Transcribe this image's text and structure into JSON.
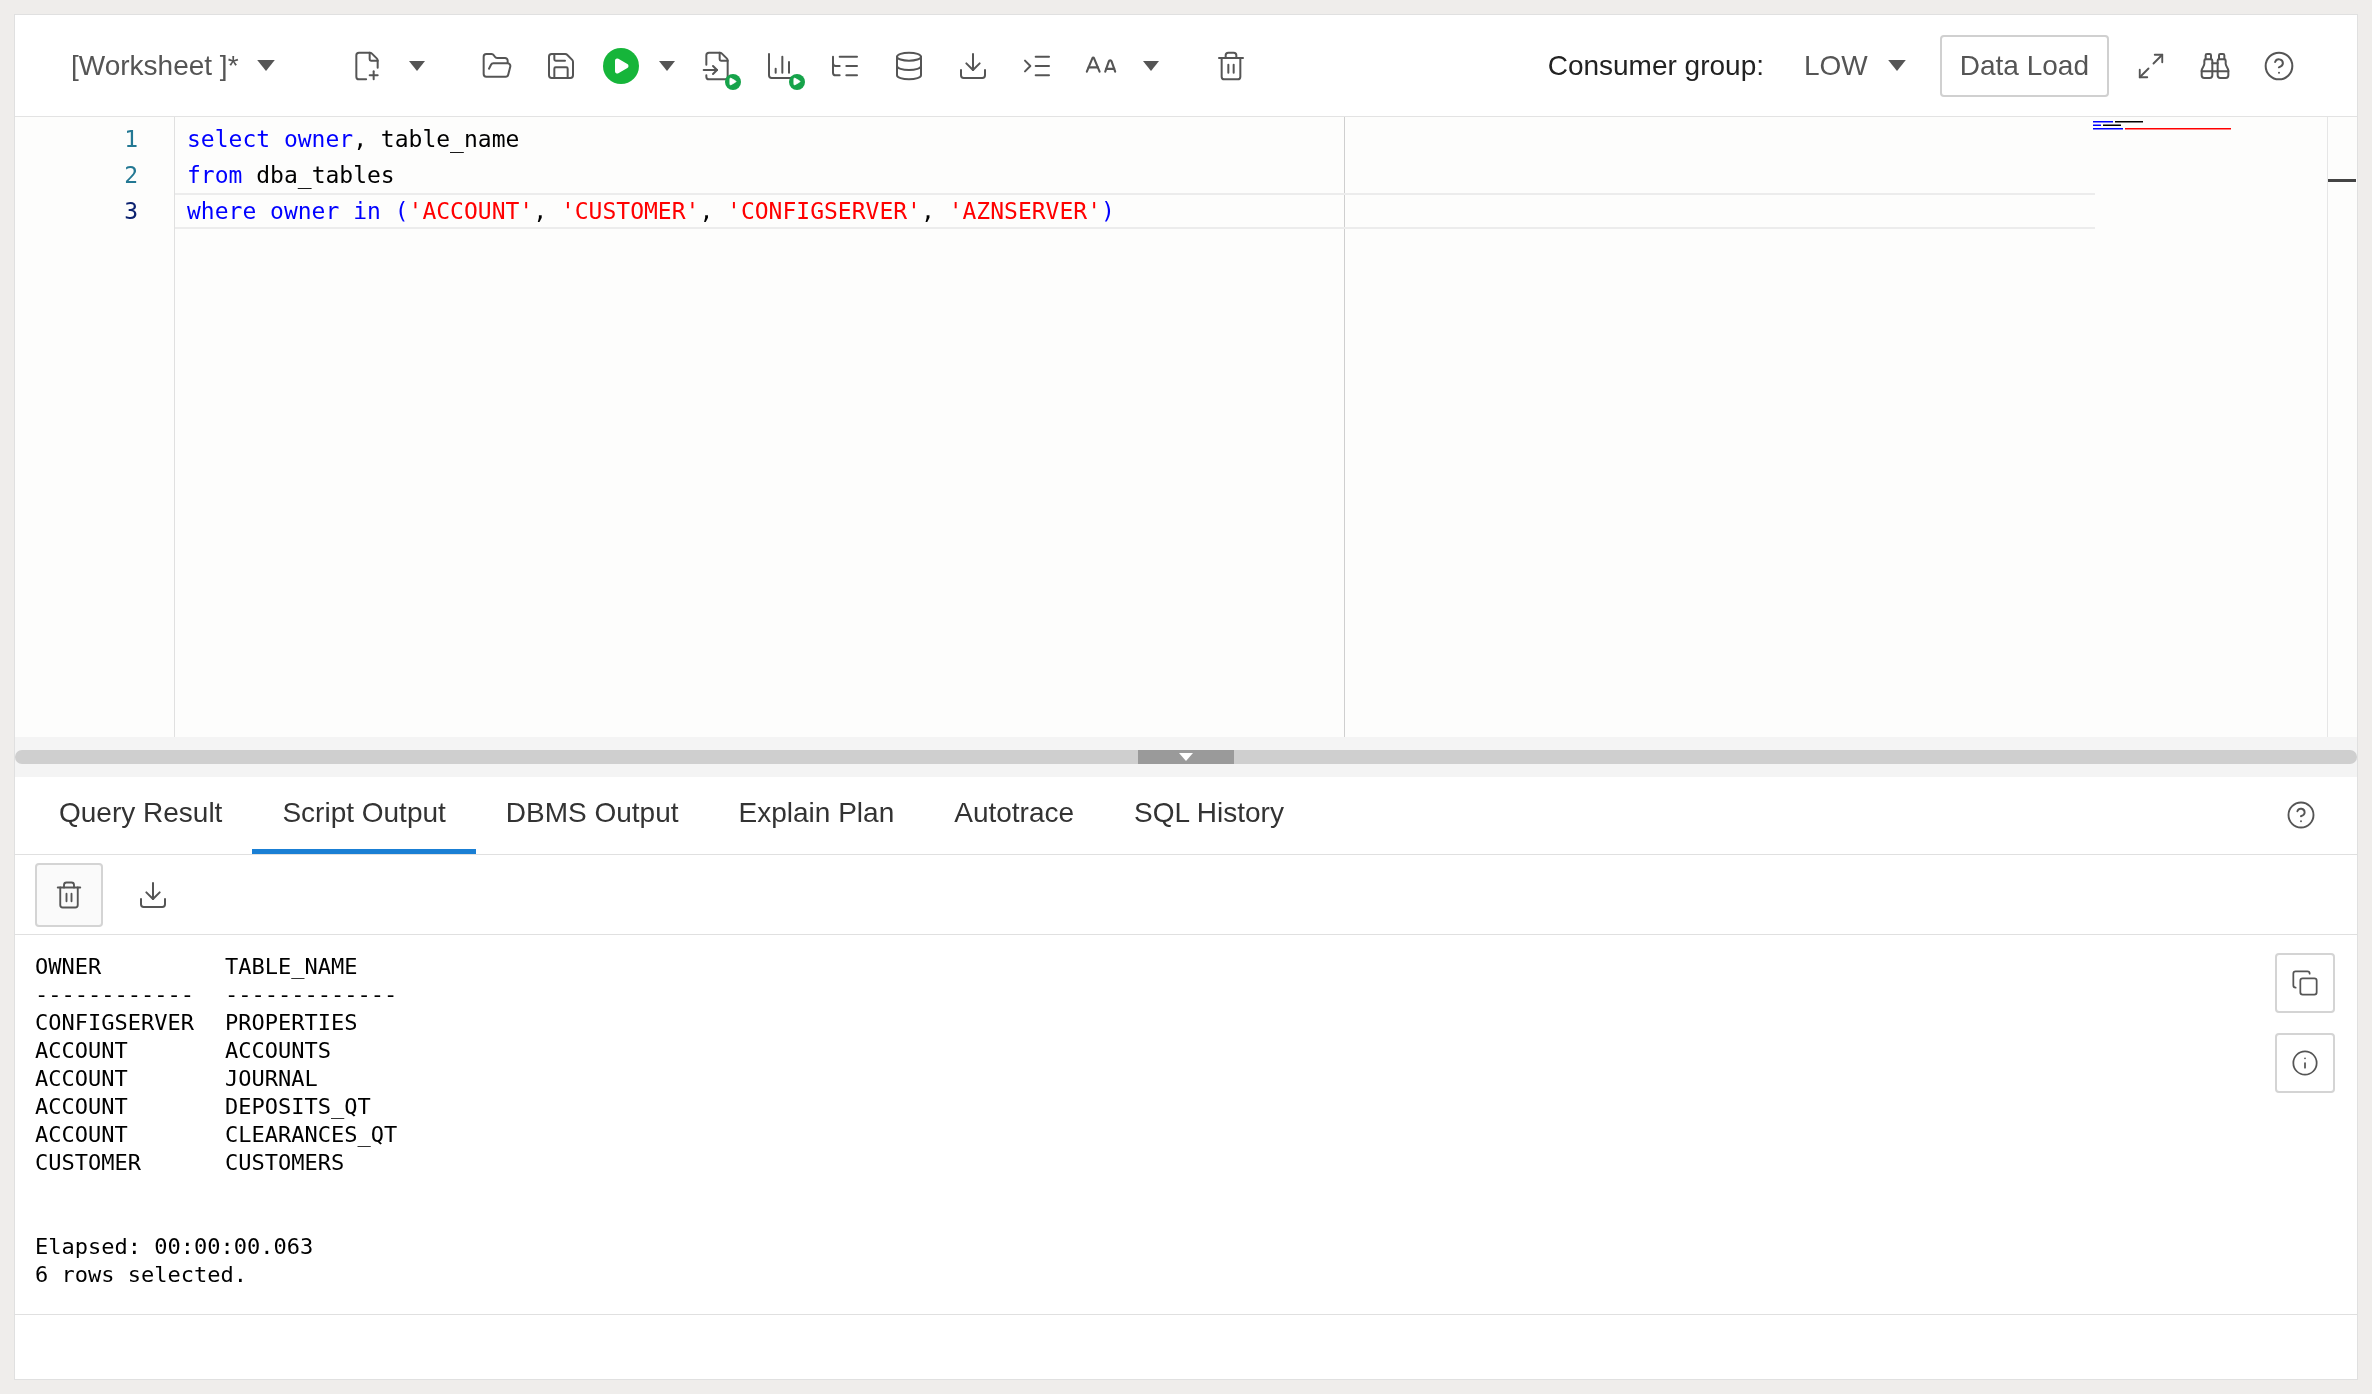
{
  "toolbar": {
    "worksheet": "[Worksheet ]*",
    "consumer_group_label": "Consumer group:",
    "consumer_group": "LOW",
    "data_load": "Data Load"
  },
  "editor": {
    "lines": [
      {
        "number": "1",
        "current": false,
        "tokens": [
          {
            "kind": "keyword",
            "text": "select owner"
          },
          {
            "kind": "plain",
            "text": ", table_name"
          }
        ]
      },
      {
        "number": "2",
        "current": false,
        "tokens": [
          {
            "kind": "keyword",
            "text": "from"
          },
          {
            "kind": "plain",
            "text": " dba_tables"
          }
        ]
      },
      {
        "number": "3",
        "current": true,
        "tokens": [
          {
            "kind": "keyword",
            "text": "where owner in ("
          },
          {
            "kind": "string",
            "text": "'ACCOUNT'"
          },
          {
            "kind": "plain",
            "text": ", "
          },
          {
            "kind": "string",
            "text": "'CUSTOMER'"
          },
          {
            "kind": "plain",
            "text": ", "
          },
          {
            "kind": "string",
            "text": "'CONFIGSERVER'"
          },
          {
            "kind": "plain",
            "text": ", "
          },
          {
            "kind": "string",
            "text": "'AZNSERVER'"
          },
          {
            "kind": "keyword",
            "text": ")"
          }
        ]
      }
    ]
  },
  "tabs": [
    {
      "label": "Query Result",
      "selected": false
    },
    {
      "label": "Script Output",
      "selected": true
    },
    {
      "label": "DBMS Output",
      "selected": false
    },
    {
      "label": "Explain Plan",
      "selected": false
    },
    {
      "label": "Autotrace",
      "selected": false
    },
    {
      "label": "SQL History",
      "selected": false
    }
  ],
  "output": {
    "header": [
      "OWNER",
      "TABLE_NAME"
    ],
    "separator": [
      "------------",
      "-------------"
    ],
    "rows": [
      [
        "CONFIGSERVER",
        "PROPERTIES"
      ],
      [
        "ACCOUNT",
        "ACCOUNTS"
      ],
      [
        "ACCOUNT",
        "JOURNAL"
      ],
      [
        "ACCOUNT",
        "DEPOSITS_QT"
      ],
      [
        "ACCOUNT",
        "CLEARANCES_QT"
      ],
      [
        "CUSTOMER",
        "CUSTOMERS"
      ]
    ],
    "footer": [
      "Elapsed: 00:00:00.063",
      "6 rows selected."
    ]
  }
}
